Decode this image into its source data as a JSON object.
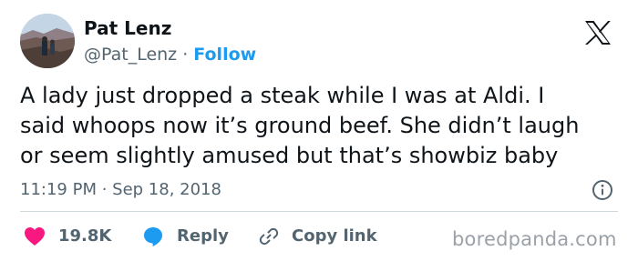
{
  "author": {
    "name": "Pat Lenz",
    "handle": "@Pat_Lenz",
    "separator": "·",
    "follow_label": "Follow"
  },
  "tweet": {
    "lines": [
      "A lady just dropped a steak while I was at Aldi. I",
      "said whoops now it’s ground beef. She didn’t laugh",
      "or seem slightly amused but that’s showbiz baby"
    ],
    "timestamp": "11:19 PM · Sep 18, 2018"
  },
  "actions": {
    "like_count": "19.8K",
    "reply_label": "Reply",
    "copy_label": "Copy link"
  },
  "icons": {
    "logo": "x-logo-icon",
    "info": "info-icon",
    "like": "heart-icon",
    "reply": "speech-bubble-icon",
    "copy": "link-icon"
  },
  "colors": {
    "accent": "#1d9bf0",
    "like": "#f91880",
    "muted": "#536471",
    "text": "#0f1419"
  },
  "watermark": "boredpanda.com"
}
